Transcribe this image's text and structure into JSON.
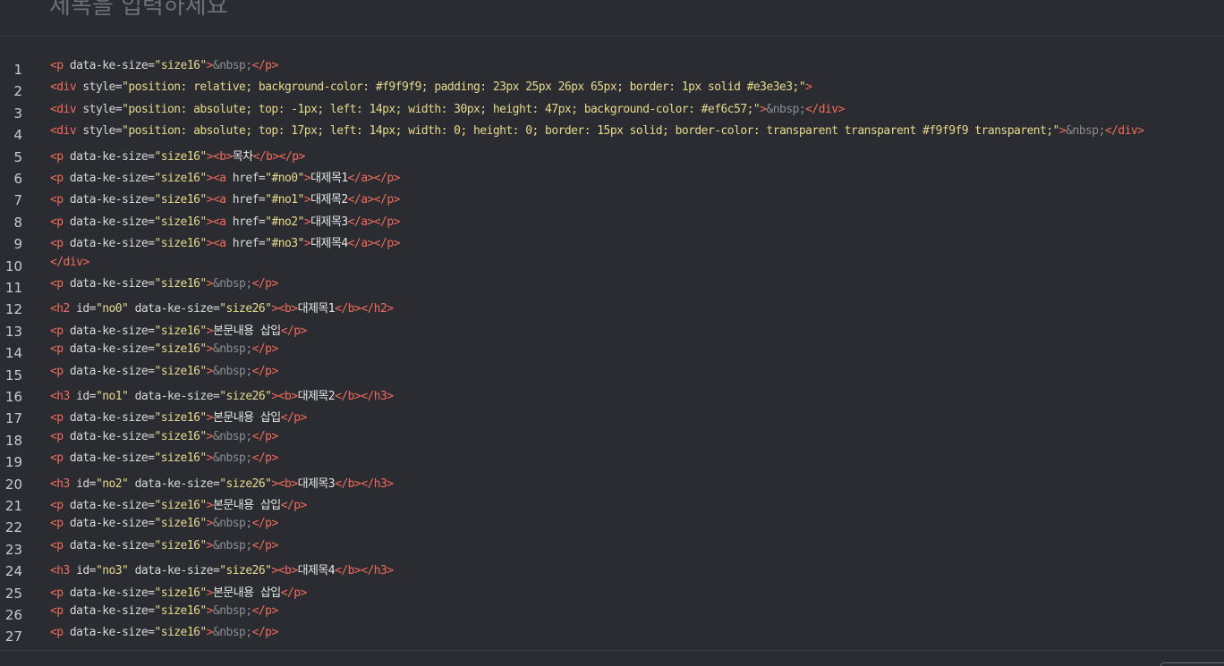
{
  "header": {
    "title": "제목을 입력하세요"
  },
  "colors": {
    "background": "#2a2c31",
    "tag": "#f26b5b",
    "string": "#e6d98c",
    "entity": "#8a8d93",
    "text": "#e6e6e6",
    "line_number": "#c9cbd0"
  },
  "editor": {
    "lines": [
      {
        "n": "1",
        "tokens": [
          [
            "tag",
            "<p "
          ],
          [
            "attr",
            "data-ke-size="
          ],
          [
            "str",
            "\"size16\""
          ],
          [
            "tag",
            ">"
          ],
          [
            "ent",
            "&nbsp;"
          ],
          [
            "tag",
            "</p>"
          ]
        ]
      },
      {
        "n": "2",
        "tokens": [
          [
            "tag",
            "<div "
          ],
          [
            "attr",
            "style="
          ],
          [
            "str",
            "\"position: relative; background-color: #f9f9f9; padding: 23px 25px 26px 65px; border: 1px solid #e3e3e3;\""
          ],
          [
            "tag",
            ">"
          ]
        ]
      },
      {
        "n": "3",
        "tokens": [
          [
            "tag",
            "<div "
          ],
          [
            "attr",
            "style="
          ],
          [
            "str",
            "\"position: absolute; top: -1px; left: 14px; width: 30px; height: 47px; background-color: #ef6c57;\""
          ],
          [
            "tag",
            ">"
          ],
          [
            "ent",
            "&nbsp;"
          ],
          [
            "tag",
            "</div>"
          ]
        ]
      },
      {
        "n": "4",
        "tokens": [
          [
            "tag",
            "<div "
          ],
          [
            "attr",
            "style="
          ],
          [
            "str",
            "\"position: absolute; top: 17px; left: 14px; width: 0; height: 0; border: 15px solid; border-color: transparent transparent #f9f9f9 transparent;\""
          ],
          [
            "tag",
            ">"
          ],
          [
            "ent",
            "&nbsp;"
          ],
          [
            "tag",
            "</div>"
          ]
        ]
      },
      {
        "n": "5",
        "tokens": [
          [
            "tag",
            "<p "
          ],
          [
            "attr",
            "data-ke-size="
          ],
          [
            "str",
            "\"size16\""
          ],
          [
            "tag",
            ">"
          ],
          [
            "tag",
            "<b>"
          ],
          [
            "txt",
            "목차"
          ],
          [
            "tag",
            "</b>"
          ],
          [
            "tag",
            "</p>"
          ]
        ]
      },
      {
        "n": "6",
        "tokens": [
          [
            "tag",
            "<p "
          ],
          [
            "attr",
            "data-ke-size="
          ],
          [
            "str",
            "\"size16\""
          ],
          [
            "tag",
            ">"
          ],
          [
            "tag",
            "<a "
          ],
          [
            "attr",
            "href="
          ],
          [
            "str",
            "\"#no0\""
          ],
          [
            "tag",
            ">"
          ],
          [
            "txt",
            "대제목1"
          ],
          [
            "tag",
            "</a>"
          ],
          [
            "tag",
            "</p>"
          ]
        ]
      },
      {
        "n": "7",
        "tokens": [
          [
            "tag",
            "<p "
          ],
          [
            "attr",
            "data-ke-size="
          ],
          [
            "str",
            "\"size16\""
          ],
          [
            "tag",
            ">"
          ],
          [
            "tag",
            "<a "
          ],
          [
            "attr",
            "href="
          ],
          [
            "str",
            "\"#no1\""
          ],
          [
            "tag",
            ">"
          ],
          [
            "txt",
            "대제목2"
          ],
          [
            "tag",
            "</a>"
          ],
          [
            "tag",
            "</p>"
          ]
        ]
      },
      {
        "n": "8",
        "tokens": [
          [
            "tag",
            "<p "
          ],
          [
            "attr",
            "data-ke-size="
          ],
          [
            "str",
            "\"size16\""
          ],
          [
            "tag",
            ">"
          ],
          [
            "tag",
            "<a "
          ],
          [
            "attr",
            "href="
          ],
          [
            "str",
            "\"#no2\""
          ],
          [
            "tag",
            ">"
          ],
          [
            "txt",
            "대제목3"
          ],
          [
            "tag",
            "</a>"
          ],
          [
            "tag",
            "</p>"
          ]
        ]
      },
      {
        "n": "9",
        "tokens": [
          [
            "tag",
            "<p "
          ],
          [
            "attr",
            "data-ke-size="
          ],
          [
            "str",
            "\"size16\""
          ],
          [
            "tag",
            ">"
          ],
          [
            "tag",
            "<a "
          ],
          [
            "attr",
            "href="
          ],
          [
            "str",
            "\"#no3\""
          ],
          [
            "tag",
            ">"
          ],
          [
            "txt",
            "대제목4"
          ],
          [
            "tag",
            "</a>"
          ],
          [
            "tag",
            "</p>"
          ]
        ]
      },
      {
        "n": "10",
        "tokens": [
          [
            "tag",
            "</div>"
          ]
        ]
      },
      {
        "n": "11",
        "tokens": [
          [
            "tag",
            "<p "
          ],
          [
            "attr",
            "data-ke-size="
          ],
          [
            "str",
            "\"size16\""
          ],
          [
            "tag",
            ">"
          ],
          [
            "ent",
            "&nbsp;"
          ],
          [
            "tag",
            "</p>"
          ]
        ]
      },
      {
        "n": "12",
        "tokens": [
          [
            "tag",
            "<h2 "
          ],
          [
            "attr",
            "id="
          ],
          [
            "str",
            "\"no0\""
          ],
          [
            "attr",
            " data-ke-size="
          ],
          [
            "str",
            "\"size26\""
          ],
          [
            "tag",
            ">"
          ],
          [
            "tag",
            "<b>"
          ],
          [
            "txt",
            "대제목1"
          ],
          [
            "tag",
            "</b>"
          ],
          [
            "tag",
            "</h2>"
          ]
        ]
      },
      {
        "n": "13",
        "tokens": [
          [
            "tag",
            "<p "
          ],
          [
            "attr",
            "data-ke-size="
          ],
          [
            "str",
            "\"size16\""
          ],
          [
            "tag",
            ">"
          ],
          [
            "txt",
            "본문내용 삽입"
          ],
          [
            "tag",
            "</p>"
          ]
        ]
      },
      {
        "n": "14",
        "tokens": [
          [
            "tag",
            "<p "
          ],
          [
            "attr",
            "data-ke-size="
          ],
          [
            "str",
            "\"size16\""
          ],
          [
            "tag",
            ">"
          ],
          [
            "ent",
            "&nbsp;"
          ],
          [
            "tag",
            "</p>"
          ]
        ]
      },
      {
        "n": "15",
        "tokens": [
          [
            "tag",
            "<p "
          ],
          [
            "attr",
            "data-ke-size="
          ],
          [
            "str",
            "\"size16\""
          ],
          [
            "tag",
            ">"
          ],
          [
            "ent",
            "&nbsp;"
          ],
          [
            "tag",
            "</p>"
          ]
        ]
      },
      {
        "n": "16",
        "tokens": [
          [
            "tag",
            "<h3 "
          ],
          [
            "attr",
            "id="
          ],
          [
            "str",
            "\"no1\""
          ],
          [
            "attr",
            " data-ke-size="
          ],
          [
            "str",
            "\"size26\""
          ],
          [
            "tag",
            ">"
          ],
          [
            "tag",
            "<b>"
          ],
          [
            "txt",
            "대제목2"
          ],
          [
            "tag",
            "</b>"
          ],
          [
            "tag",
            "</h3>"
          ]
        ]
      },
      {
        "n": "17",
        "tokens": [
          [
            "tag",
            "<p "
          ],
          [
            "attr",
            "data-ke-size="
          ],
          [
            "str",
            "\"size16\""
          ],
          [
            "tag",
            ">"
          ],
          [
            "txt",
            "본문내용 삽입"
          ],
          [
            "tag",
            "</p>"
          ]
        ]
      },
      {
        "n": "18",
        "tokens": [
          [
            "tag",
            "<p "
          ],
          [
            "attr",
            "data-ke-size="
          ],
          [
            "str",
            "\"size16\""
          ],
          [
            "tag",
            ">"
          ],
          [
            "ent",
            "&nbsp;"
          ],
          [
            "tag",
            "</p>"
          ]
        ]
      },
      {
        "n": "19",
        "tokens": [
          [
            "tag",
            "<p "
          ],
          [
            "attr",
            "data-ke-size="
          ],
          [
            "str",
            "\"size16\""
          ],
          [
            "tag",
            ">"
          ],
          [
            "ent",
            "&nbsp;"
          ],
          [
            "tag",
            "</p>"
          ]
        ]
      },
      {
        "n": "20",
        "tokens": [
          [
            "tag",
            "<h3 "
          ],
          [
            "attr",
            "id="
          ],
          [
            "str",
            "\"no2\""
          ],
          [
            "attr",
            " data-ke-size="
          ],
          [
            "str",
            "\"size26\""
          ],
          [
            "tag",
            ">"
          ],
          [
            "tag",
            "<b>"
          ],
          [
            "txt",
            "대제목3"
          ],
          [
            "tag",
            "</b>"
          ],
          [
            "tag",
            "</h3>"
          ]
        ]
      },
      {
        "n": "21",
        "tokens": [
          [
            "tag",
            "<p "
          ],
          [
            "attr",
            "data-ke-size="
          ],
          [
            "str",
            "\"size16\""
          ],
          [
            "tag",
            ">"
          ],
          [
            "txt",
            "본문내용 삽입"
          ],
          [
            "tag",
            "</p>"
          ]
        ]
      },
      {
        "n": "22",
        "tokens": [
          [
            "tag",
            "<p "
          ],
          [
            "attr",
            "data-ke-size="
          ],
          [
            "str",
            "\"size16\""
          ],
          [
            "tag",
            ">"
          ],
          [
            "ent",
            "&nbsp;"
          ],
          [
            "tag",
            "</p>"
          ]
        ]
      },
      {
        "n": "23",
        "tokens": [
          [
            "tag",
            "<p "
          ],
          [
            "attr",
            "data-ke-size="
          ],
          [
            "str",
            "\"size16\""
          ],
          [
            "tag",
            ">"
          ],
          [
            "ent",
            "&nbsp;"
          ],
          [
            "tag",
            "</p>"
          ]
        ]
      },
      {
        "n": "24",
        "tokens": [
          [
            "tag",
            "<h3 "
          ],
          [
            "attr",
            "id="
          ],
          [
            "str",
            "\"no3\""
          ],
          [
            "attr",
            " data-ke-size="
          ],
          [
            "str",
            "\"size26\""
          ],
          [
            "tag",
            ">"
          ],
          [
            "tag",
            "<b>"
          ],
          [
            "txt",
            "대제목4"
          ],
          [
            "tag",
            "</b>"
          ],
          [
            "tag",
            "</h3>"
          ]
        ]
      },
      {
        "n": "25",
        "tokens": [
          [
            "tag",
            "<p "
          ],
          [
            "attr",
            "data-ke-size="
          ],
          [
            "str",
            "\"size16\""
          ],
          [
            "tag",
            ">"
          ],
          [
            "txt",
            "본문내용 삽입"
          ],
          [
            "tag",
            "</p>"
          ]
        ]
      },
      {
        "n": "26",
        "tokens": [
          [
            "tag",
            "<p "
          ],
          [
            "attr",
            "data-ke-size="
          ],
          [
            "str",
            "\"size16\""
          ],
          [
            "tag",
            ">"
          ],
          [
            "ent",
            "&nbsp;"
          ],
          [
            "tag",
            "</p>"
          ]
        ]
      },
      {
        "n": "27",
        "tokens": [
          [
            "tag",
            "<p "
          ],
          [
            "attr",
            "data-ke-size="
          ],
          [
            "str",
            "\"size16\""
          ],
          [
            "tag",
            ">"
          ],
          [
            "ent",
            "&nbsp;"
          ],
          [
            "tag",
            "</p>"
          ]
        ]
      }
    ]
  }
}
